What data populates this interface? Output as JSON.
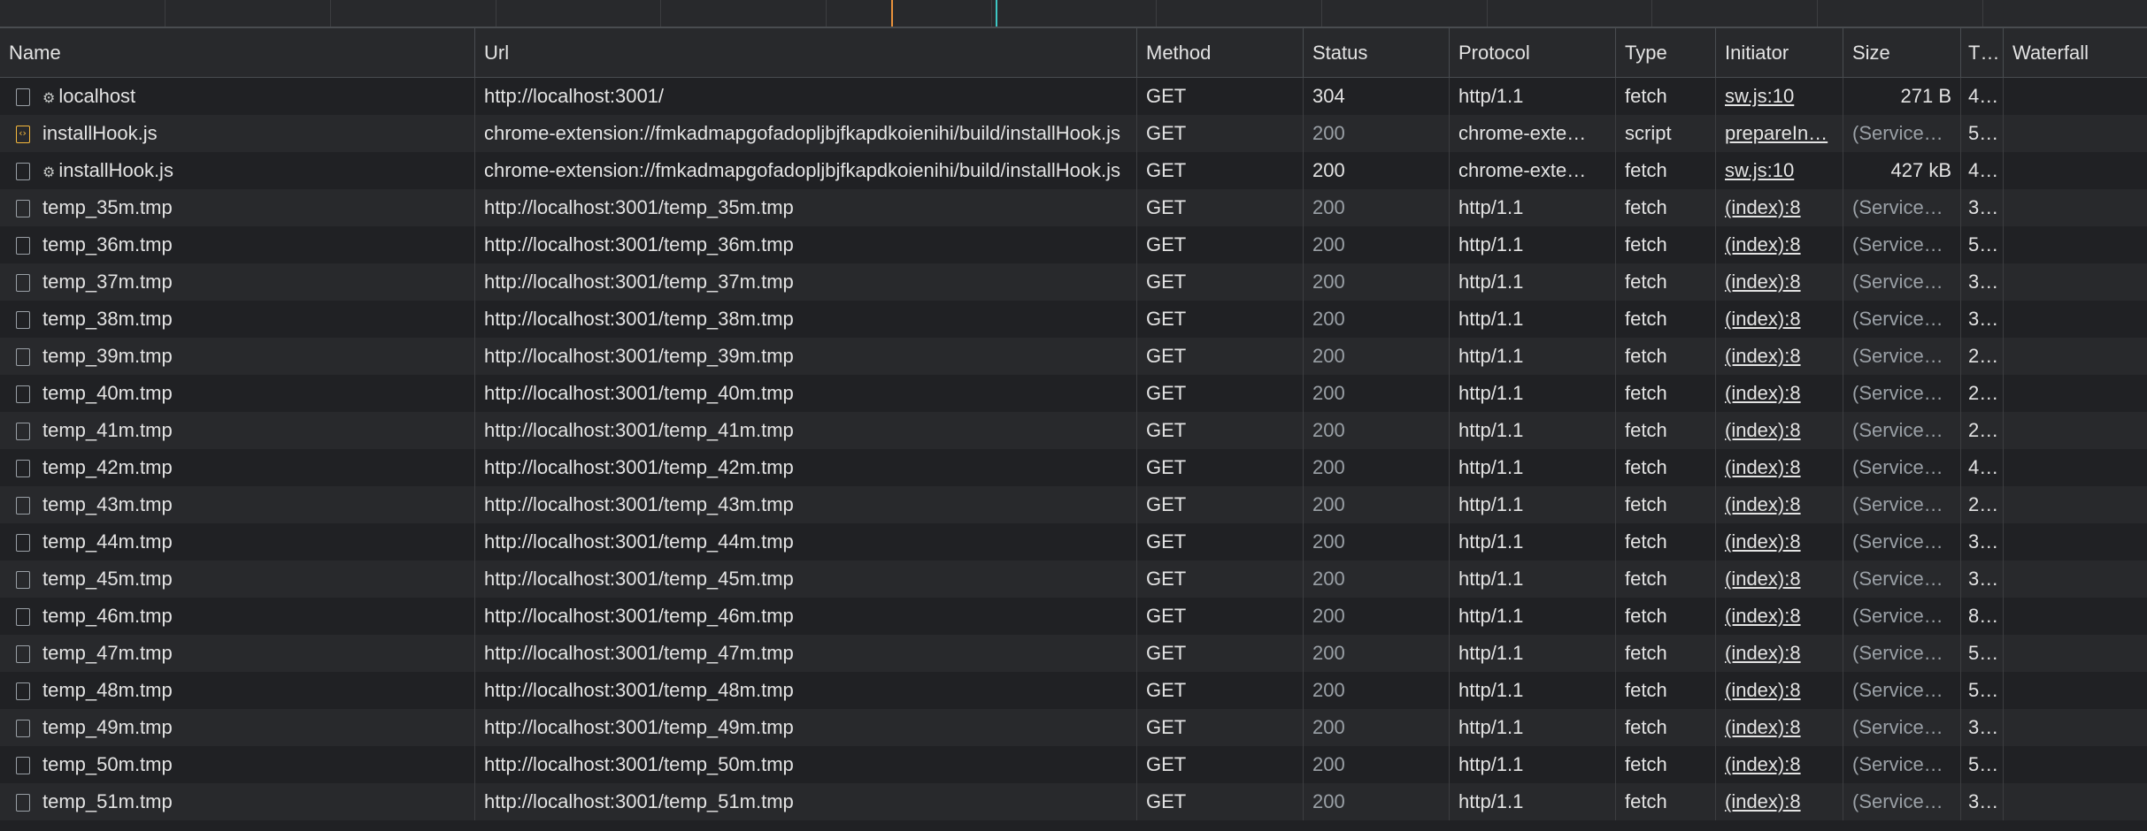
{
  "columns": {
    "name": "Name",
    "url": "Url",
    "method": "Method",
    "status": "Status",
    "protocol": "Protocol",
    "type": "Type",
    "initiator": "Initiator",
    "size": "Size",
    "time": "T…",
    "waterfall": "Waterfall"
  },
  "rows": [
    {
      "icon": "document-icon",
      "gear": true,
      "name": "localhost",
      "url": "http://localhost:3001/",
      "method": "GET",
      "status": "304",
      "protocol": "http/1.1",
      "type": "fetch",
      "initiator": "sw.js:10",
      "size": "271 B",
      "time": "4…",
      "dim": false
    },
    {
      "icon": "script-icon",
      "gear": false,
      "name": "installHook.js",
      "url": "chrome-extension://fmkadmapgofadopljbjfkapdkoienihi/build/installHook.js",
      "method": "GET",
      "status": "200",
      "protocol": "chrome-exte…",
      "type": "script",
      "initiator": "prepareIn…",
      "size": "(Service…",
      "time": "5…",
      "dim": true
    },
    {
      "icon": "document-icon",
      "gear": true,
      "name": "installHook.js",
      "url": "chrome-extension://fmkadmapgofadopljbjfkapdkoienihi/build/installHook.js",
      "method": "GET",
      "status": "200",
      "protocol": "chrome-exte…",
      "type": "fetch",
      "initiator": "sw.js:10",
      "size": "427 kB",
      "time": "4…",
      "dim": false
    },
    {
      "icon": "document-icon",
      "gear": false,
      "name": "temp_35m.tmp",
      "url": "http://localhost:3001/temp_35m.tmp",
      "method": "GET",
      "status": "200",
      "protocol": "http/1.1",
      "type": "fetch",
      "initiator": "(index):8",
      "size": "(Service…",
      "time": "3…",
      "dim": true
    },
    {
      "icon": "document-icon",
      "gear": false,
      "name": "temp_36m.tmp",
      "url": "http://localhost:3001/temp_36m.tmp",
      "method": "GET",
      "status": "200",
      "protocol": "http/1.1",
      "type": "fetch",
      "initiator": "(index):8",
      "size": "(Service…",
      "time": "5…",
      "dim": true
    },
    {
      "icon": "document-icon",
      "gear": false,
      "name": "temp_37m.tmp",
      "url": "http://localhost:3001/temp_37m.tmp",
      "method": "GET",
      "status": "200",
      "protocol": "http/1.1",
      "type": "fetch",
      "initiator": "(index):8",
      "size": "(Service…",
      "time": "3…",
      "dim": true
    },
    {
      "icon": "document-icon",
      "gear": false,
      "name": "temp_38m.tmp",
      "url": "http://localhost:3001/temp_38m.tmp",
      "method": "GET",
      "status": "200",
      "protocol": "http/1.1",
      "type": "fetch",
      "initiator": "(index):8",
      "size": "(Service…",
      "time": "3…",
      "dim": true
    },
    {
      "icon": "document-icon",
      "gear": false,
      "name": "temp_39m.tmp",
      "url": "http://localhost:3001/temp_39m.tmp",
      "method": "GET",
      "status": "200",
      "protocol": "http/1.1",
      "type": "fetch",
      "initiator": "(index):8",
      "size": "(Service…",
      "time": "2…",
      "dim": true
    },
    {
      "icon": "document-icon",
      "gear": false,
      "name": "temp_40m.tmp",
      "url": "http://localhost:3001/temp_40m.tmp",
      "method": "GET",
      "status": "200",
      "protocol": "http/1.1",
      "type": "fetch",
      "initiator": "(index):8",
      "size": "(Service…",
      "time": "2…",
      "dim": true
    },
    {
      "icon": "document-icon",
      "gear": false,
      "name": "temp_41m.tmp",
      "url": "http://localhost:3001/temp_41m.tmp",
      "method": "GET",
      "status": "200",
      "protocol": "http/1.1",
      "type": "fetch",
      "initiator": "(index):8",
      "size": "(Service…",
      "time": "2…",
      "dim": true
    },
    {
      "icon": "document-icon",
      "gear": false,
      "name": "temp_42m.tmp",
      "url": "http://localhost:3001/temp_42m.tmp",
      "method": "GET",
      "status": "200",
      "protocol": "http/1.1",
      "type": "fetch",
      "initiator": "(index):8",
      "size": "(Service…",
      "time": "4…",
      "dim": true
    },
    {
      "icon": "document-icon",
      "gear": false,
      "name": "temp_43m.tmp",
      "url": "http://localhost:3001/temp_43m.tmp",
      "method": "GET",
      "status": "200",
      "protocol": "http/1.1",
      "type": "fetch",
      "initiator": "(index):8",
      "size": "(Service…",
      "time": "2…",
      "dim": true
    },
    {
      "icon": "document-icon",
      "gear": false,
      "name": "temp_44m.tmp",
      "url": "http://localhost:3001/temp_44m.tmp",
      "method": "GET",
      "status": "200",
      "protocol": "http/1.1",
      "type": "fetch",
      "initiator": "(index):8",
      "size": "(Service…",
      "time": "3…",
      "dim": true
    },
    {
      "icon": "document-icon",
      "gear": false,
      "name": "temp_45m.tmp",
      "url": "http://localhost:3001/temp_45m.tmp",
      "method": "GET",
      "status": "200",
      "protocol": "http/1.1",
      "type": "fetch",
      "initiator": "(index):8",
      "size": "(Service…",
      "time": "3…",
      "dim": true
    },
    {
      "icon": "document-icon",
      "gear": false,
      "name": "temp_46m.tmp",
      "url": "http://localhost:3001/temp_46m.tmp",
      "method": "GET",
      "status": "200",
      "protocol": "http/1.1",
      "type": "fetch",
      "initiator": "(index):8",
      "size": "(Service…",
      "time": "8…",
      "dim": true
    },
    {
      "icon": "document-icon",
      "gear": false,
      "name": "temp_47m.tmp",
      "url": "http://localhost:3001/temp_47m.tmp",
      "method": "GET",
      "status": "200",
      "protocol": "http/1.1",
      "type": "fetch",
      "initiator": "(index):8",
      "size": "(Service…",
      "time": "5…",
      "dim": true
    },
    {
      "icon": "document-icon",
      "gear": false,
      "name": "temp_48m.tmp",
      "url": "http://localhost:3001/temp_48m.tmp",
      "method": "GET",
      "status": "200",
      "protocol": "http/1.1",
      "type": "fetch",
      "initiator": "(index):8",
      "size": "(Service…",
      "time": "5…",
      "dim": true
    },
    {
      "icon": "document-icon",
      "gear": false,
      "name": "temp_49m.tmp",
      "url": "http://localhost:3001/temp_49m.tmp",
      "method": "GET",
      "status": "200",
      "protocol": "http/1.1",
      "type": "fetch",
      "initiator": "(index):8",
      "size": "(Service…",
      "time": "3…",
      "dim": true
    },
    {
      "icon": "document-icon",
      "gear": false,
      "name": "temp_50m.tmp",
      "url": "http://localhost:3001/temp_50m.tmp",
      "method": "GET",
      "status": "200",
      "protocol": "http/1.1",
      "type": "fetch",
      "initiator": "(index):8",
      "size": "(Service…",
      "time": "5…",
      "dim": true
    },
    {
      "icon": "document-icon",
      "gear": false,
      "name": "temp_51m.tmp",
      "url": "http://localhost:3001/temp_51m.tmp",
      "method": "GET",
      "status": "200",
      "protocol": "http/1.1",
      "type": "fetch",
      "initiator": "(index):8",
      "size": "(Service…",
      "time": "3…",
      "dim": true
    }
  ]
}
